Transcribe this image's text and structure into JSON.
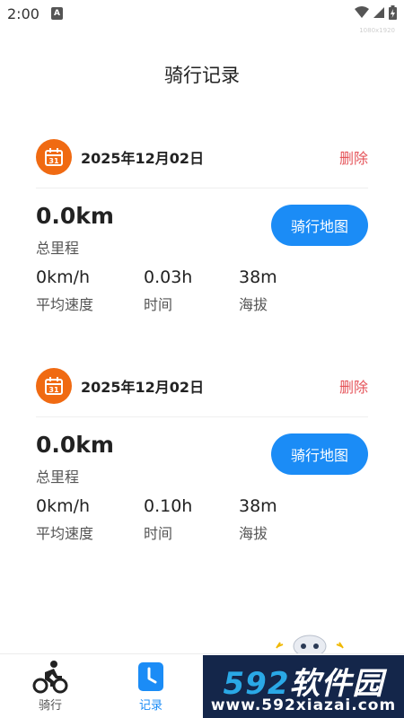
{
  "status_bar": {
    "time": "2:00",
    "notification_icon": "a-icon",
    "icons": [
      "wifi-icon",
      "signal-icon",
      "battery-icon"
    ],
    "tag": "1080x1920"
  },
  "page": {
    "title": "骑行记录"
  },
  "records": [
    {
      "date": "2025年12月02日",
      "delete_label": "删除",
      "distance": "0.0km",
      "distance_label": "总里程",
      "map_button_label": "骑行地图",
      "speed": "0km/h",
      "speed_label": "平均速度",
      "time": "0.03h",
      "time_label": "时间",
      "altitude": "38m",
      "altitude_label": "海拔"
    },
    {
      "date": "2025年12月02日",
      "delete_label": "删除",
      "distance": "0.0km",
      "distance_label": "总里程",
      "map_button_label": "骑行地图",
      "speed": "0km/h",
      "speed_label": "平均速度",
      "time": "0.10h",
      "time_label": "时间",
      "altitude": "38m",
      "altitude_label": "海拔"
    }
  ],
  "tabs": [
    {
      "label": "骑行",
      "icon": "cyclist-icon",
      "active": false
    },
    {
      "label": "记录",
      "icon": "clock-icon",
      "active": true
    }
  ],
  "watermark": {
    "title_num": "592",
    "title_text": "软件园",
    "url": "www.592xiazai.com"
  },
  "colors": {
    "accent": "#1b8cf6",
    "calendar": "#f06a12",
    "delete": "#e5545a",
    "watermark_bg": "#14264a"
  }
}
